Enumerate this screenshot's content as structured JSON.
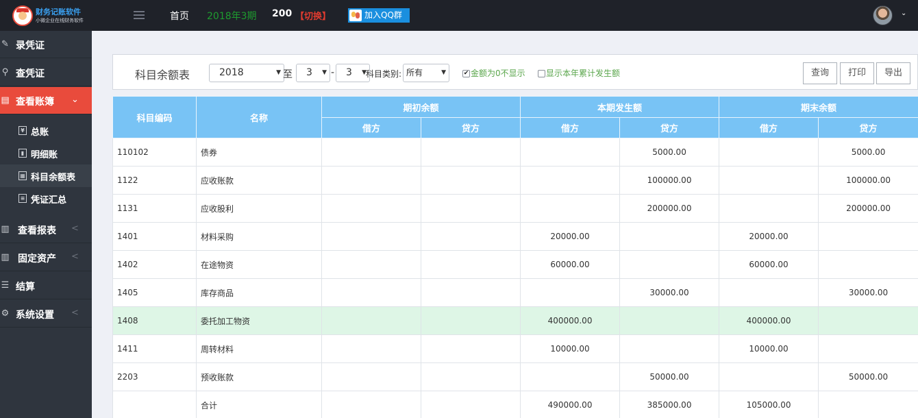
{
  "topbar": {
    "logo": {
      "title": "财务记账软件",
      "subtitle": "小微企业在线财务软件"
    },
    "nav_home": "首页",
    "period": "2018年3期",
    "count": "200",
    "switch_label": "【切换】",
    "qq_label": "加入QQ群",
    "avatar_caret": "⌄"
  },
  "sidebar": {
    "items": [
      {
        "label": "录凭证",
        "icon": "edit-icon"
      },
      {
        "label": "查凭证",
        "icon": "search-icon"
      },
      {
        "label": "查看账簿",
        "icon": "book-icon",
        "arrow": "⌄"
      },
      {
        "label": "查看报表",
        "icon": "bar-chart-icon",
        "arrow": "<"
      },
      {
        "label": "固定资产",
        "icon": "bar-chart-icon",
        "arrow": "<"
      },
      {
        "label": "结算",
        "icon": "list-icon"
      },
      {
        "label": "系统设置",
        "icon": "gear-icon",
        "arrow": "<"
      }
    ],
    "submenu": [
      {
        "label": "总账",
        "icon": "yen-icon"
      },
      {
        "label": "明细账",
        "icon": "ledger-icon"
      },
      {
        "label": "科目余额表",
        "icon": "table-icon"
      },
      {
        "label": "凭证汇总",
        "icon": "summary-icon"
      }
    ]
  },
  "toolbar": {
    "title": "科目余额表",
    "year": "2018",
    "to_label": "至",
    "period_from": "3",
    "dash": "-",
    "period_to": "3",
    "category_label": "科目类别:",
    "category_value": "所有",
    "hide_zero_label": "金额为0不显示",
    "hide_zero_checked": true,
    "show_ytd_label": "显示本年累计发生额",
    "show_ytd_checked": false,
    "query_label": "查询",
    "print_label": "打印",
    "export_label": "导出"
  },
  "table": {
    "headers": {
      "code": "科目编码",
      "name": "名称",
      "opening": "期初余额",
      "current": "本期发生额",
      "closing": "期末余额",
      "debit": "借方",
      "credit": "贷方"
    },
    "rows": [
      {
        "code": "110102",
        "name": "债券",
        "open_debit": "",
        "open_credit": "",
        "cur_debit": "",
        "cur_credit": "5000.00",
        "close_debit": "",
        "close_credit": "5000.00"
      },
      {
        "code": "1122",
        "name": "应收账款",
        "open_debit": "",
        "open_credit": "",
        "cur_debit": "",
        "cur_credit": "100000.00",
        "close_debit": "",
        "close_credit": "100000.00"
      },
      {
        "code": "1131",
        "name": "应收股利",
        "open_debit": "",
        "open_credit": "",
        "cur_debit": "",
        "cur_credit": "200000.00",
        "close_debit": "",
        "close_credit": "200000.00"
      },
      {
        "code": "1401",
        "name": "材料采购",
        "open_debit": "",
        "open_credit": "",
        "cur_debit": "20000.00",
        "cur_credit": "",
        "close_debit": "20000.00",
        "close_credit": ""
      },
      {
        "code": "1402",
        "name": "在途物资",
        "open_debit": "",
        "open_credit": "",
        "cur_debit": "60000.00",
        "cur_credit": "",
        "close_debit": "60000.00",
        "close_credit": ""
      },
      {
        "code": "1405",
        "name": "库存商品",
        "open_debit": "",
        "open_credit": "",
        "cur_debit": "",
        "cur_credit": "30000.00",
        "close_debit": "",
        "close_credit": "30000.00"
      },
      {
        "code": "1408",
        "name": "委托加工物资",
        "open_debit": "",
        "open_credit": "",
        "cur_debit": "400000.00",
        "cur_credit": "",
        "close_debit": "400000.00",
        "close_credit": ""
      },
      {
        "code": "1411",
        "name": "周转材料",
        "open_debit": "",
        "open_credit": "",
        "cur_debit": "10000.00",
        "cur_credit": "",
        "close_debit": "10000.00",
        "close_credit": ""
      },
      {
        "code": "2203",
        "name": "预收账款",
        "open_debit": "",
        "open_credit": "",
        "cur_debit": "",
        "cur_credit": "50000.00",
        "close_debit": "",
        "close_credit": "50000.00"
      },
      {
        "code": "",
        "name": "合计",
        "open_debit": "",
        "open_credit": "",
        "cur_debit": "490000.00",
        "cur_credit": "385000.00",
        "close_debit": "105000.00",
        "close_credit": ""
      }
    ]
  },
  "colors": {
    "sidebar_bg": "#2f353e",
    "active_menu": "#e94b3c",
    "header_blue": "#78c3f5",
    "highlight_row": "#def6e6",
    "period_green": "#1e9c2f",
    "switch_red": "#e23b2f"
  }
}
